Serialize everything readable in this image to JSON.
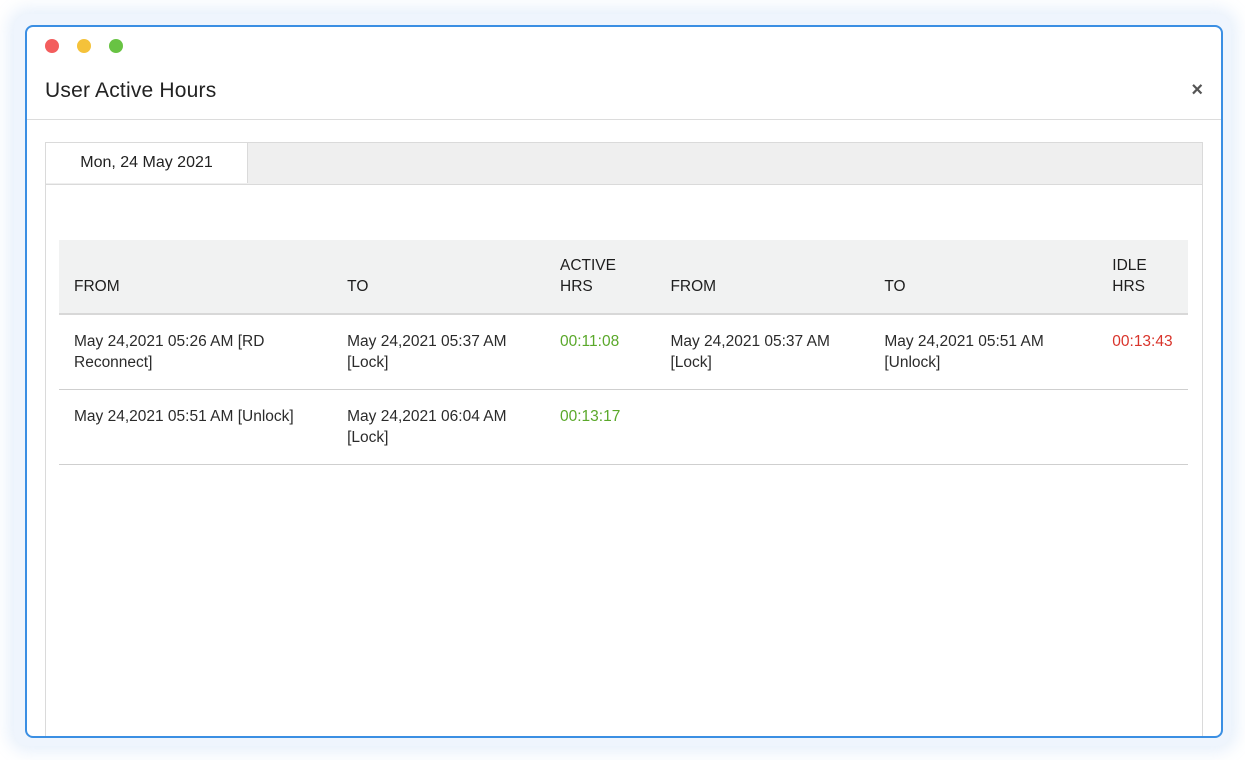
{
  "window": {
    "title": "User Active Hours",
    "close_label": "×",
    "traffic_colors": {
      "red": "#f35d5d",
      "yellow": "#f5c23a",
      "green": "#68c343"
    }
  },
  "tabs": [
    {
      "label": "Mon, 24 May 2021",
      "selected": true
    }
  ],
  "table": {
    "headers": {
      "active_from": "FROM",
      "active_to": "TO",
      "active_hrs_line1": "ACTIVE",
      "active_hrs_line2": "HRS",
      "idle_from": "FROM",
      "idle_to": "TO",
      "idle_hrs_line1": "IDLE",
      "idle_hrs_line2": "HRS"
    },
    "rows": [
      {
        "active_from": "May 24,2021 05:26 AM [RD Reconnect]",
        "active_to": "May 24,2021 05:37 AM [Lock]",
        "active_hrs": "00:11:08",
        "idle_from": "May 24,2021 05:37 AM [Lock]",
        "idle_to": "May 24,2021 05:51 AM [Unlock]",
        "idle_hrs": "00:13:43"
      },
      {
        "active_from": "May 24,2021 05:51 AM [Unlock]",
        "active_to": "May 24,2021 06:04 AM [Lock]",
        "active_hrs": "00:13:17",
        "idle_from": "",
        "idle_to": "",
        "idle_hrs": ""
      }
    ]
  },
  "colors": {
    "active_hrs": "#5aa82a",
    "idle_hrs": "#d9342b",
    "window_border": "#3b8fe3"
  }
}
